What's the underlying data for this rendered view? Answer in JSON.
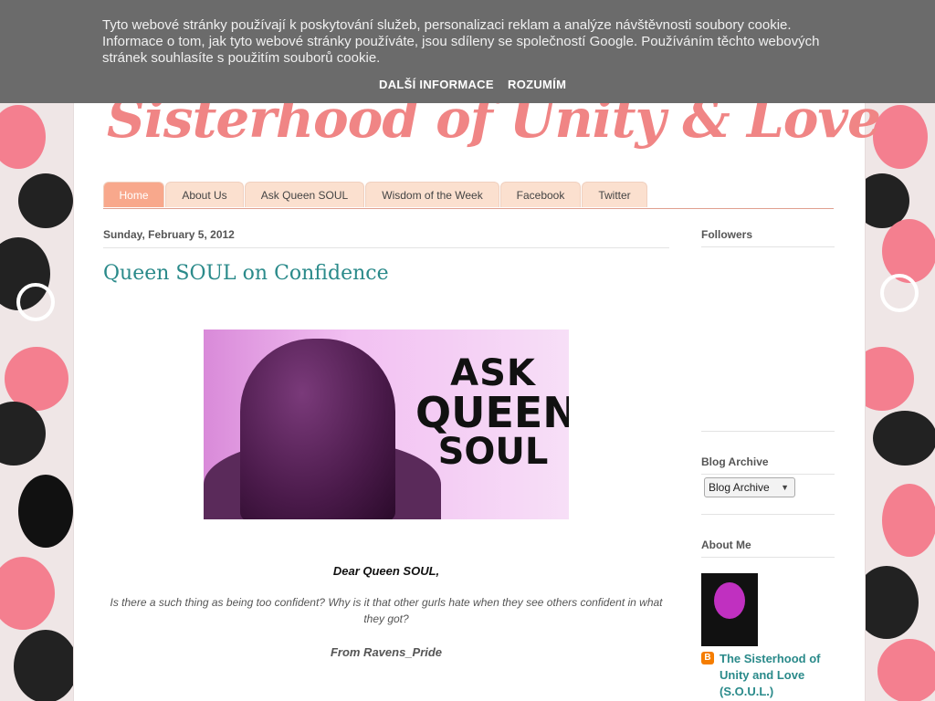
{
  "cookie_notice": {
    "text": "Tyto webové stránky používají k poskytování služeb, personalizaci reklam a analýze návštěvnosti soubory cookie. Informace o tom, jak tyto webové stránky používáte, jsou sdíleny se společností Google. Používáním těchto webových stránek souhlasíte s použitím souborů cookie.",
    "more_info_label": "DALŠÍ INFORMACE",
    "accept_label": "ROZUMÍM"
  },
  "blog": {
    "title": "Sisterhood of Unity & Love"
  },
  "nav": {
    "tabs": [
      {
        "label": "Home",
        "active": true
      },
      {
        "label": "About Us",
        "active": false
      },
      {
        "label": "Ask Queen SOUL",
        "active": false
      },
      {
        "label": "Wisdom of the Week",
        "active": false
      },
      {
        "label": "Facebook",
        "active": false
      },
      {
        "label": "Twitter",
        "active": false
      }
    ]
  },
  "post": {
    "date": "Sunday, February 5, 2012",
    "title": "Queen SOUL on Confidence",
    "image_text": [
      "ASK",
      "QUEEN",
      "SOUL"
    ],
    "salutation": "Dear Queen SOUL,",
    "question": "Is there a such thing as being too confident? Why is it that other gurls hate when they see others confident in what they got?",
    "signoff": "From Ravens_Pride"
  },
  "sidebar": {
    "followers_heading": "Followers",
    "archive_heading": "Blog Archive",
    "archive_select_value": "Blog Archive",
    "about_heading": "About Me",
    "profile_name": "The Sisterhood of Unity and Love (S.O.U.L.)"
  },
  "colors": {
    "title_pink": "#f08585",
    "link_teal": "#2a8a8a",
    "tab_bg": "#fbe0cf",
    "tab_active": "#f8a88c",
    "cookie_bar": "#6b6b6b"
  }
}
